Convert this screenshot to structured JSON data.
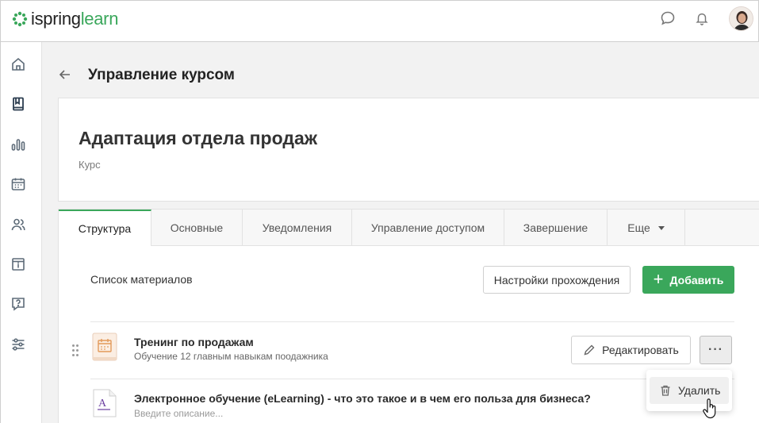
{
  "app": {
    "logo_part1": "ispring",
    "logo_part2": "learn",
    "brand_color": "#3aa75b"
  },
  "topbar": {
    "icons": [
      "chat-icon",
      "bell-icon"
    ],
    "avatar": "user-avatar"
  },
  "sidebar": {
    "icons": [
      "home-icon",
      "book-icon",
      "bar-chart-icon",
      "calendar-icon",
      "users-icon",
      "info-icon",
      "question-icon",
      "sliders-icon"
    ]
  },
  "header": {
    "title": "Управление курсом"
  },
  "course": {
    "title": "Адаптация отдела продаж",
    "type": "Курс"
  },
  "tabs": [
    {
      "label": "Структура"
    },
    {
      "label": "Основные"
    },
    {
      "label": "Уведомления"
    },
    {
      "label": "Управление доступом"
    },
    {
      "label": "Завершение"
    },
    {
      "label": "Еще"
    }
  ],
  "materials": {
    "label": "Список материалов",
    "settings_button": "Настройки прохождения",
    "add_button": "Добавить",
    "items": [
      {
        "title": "Тренинг по продажам",
        "description": "Обучение 12 главным навыкам поодажника",
        "icon": "calendar-training-icon",
        "edit_button": "Редактировать",
        "more_button": "···"
      },
      {
        "title": "Электронное обучение (eLearning) - что это такое и в чем его польза для бизнеса?",
        "description": "Введите описание...",
        "icon": "document-icon"
      }
    ],
    "menu": {
      "delete": "Удалить"
    }
  }
}
